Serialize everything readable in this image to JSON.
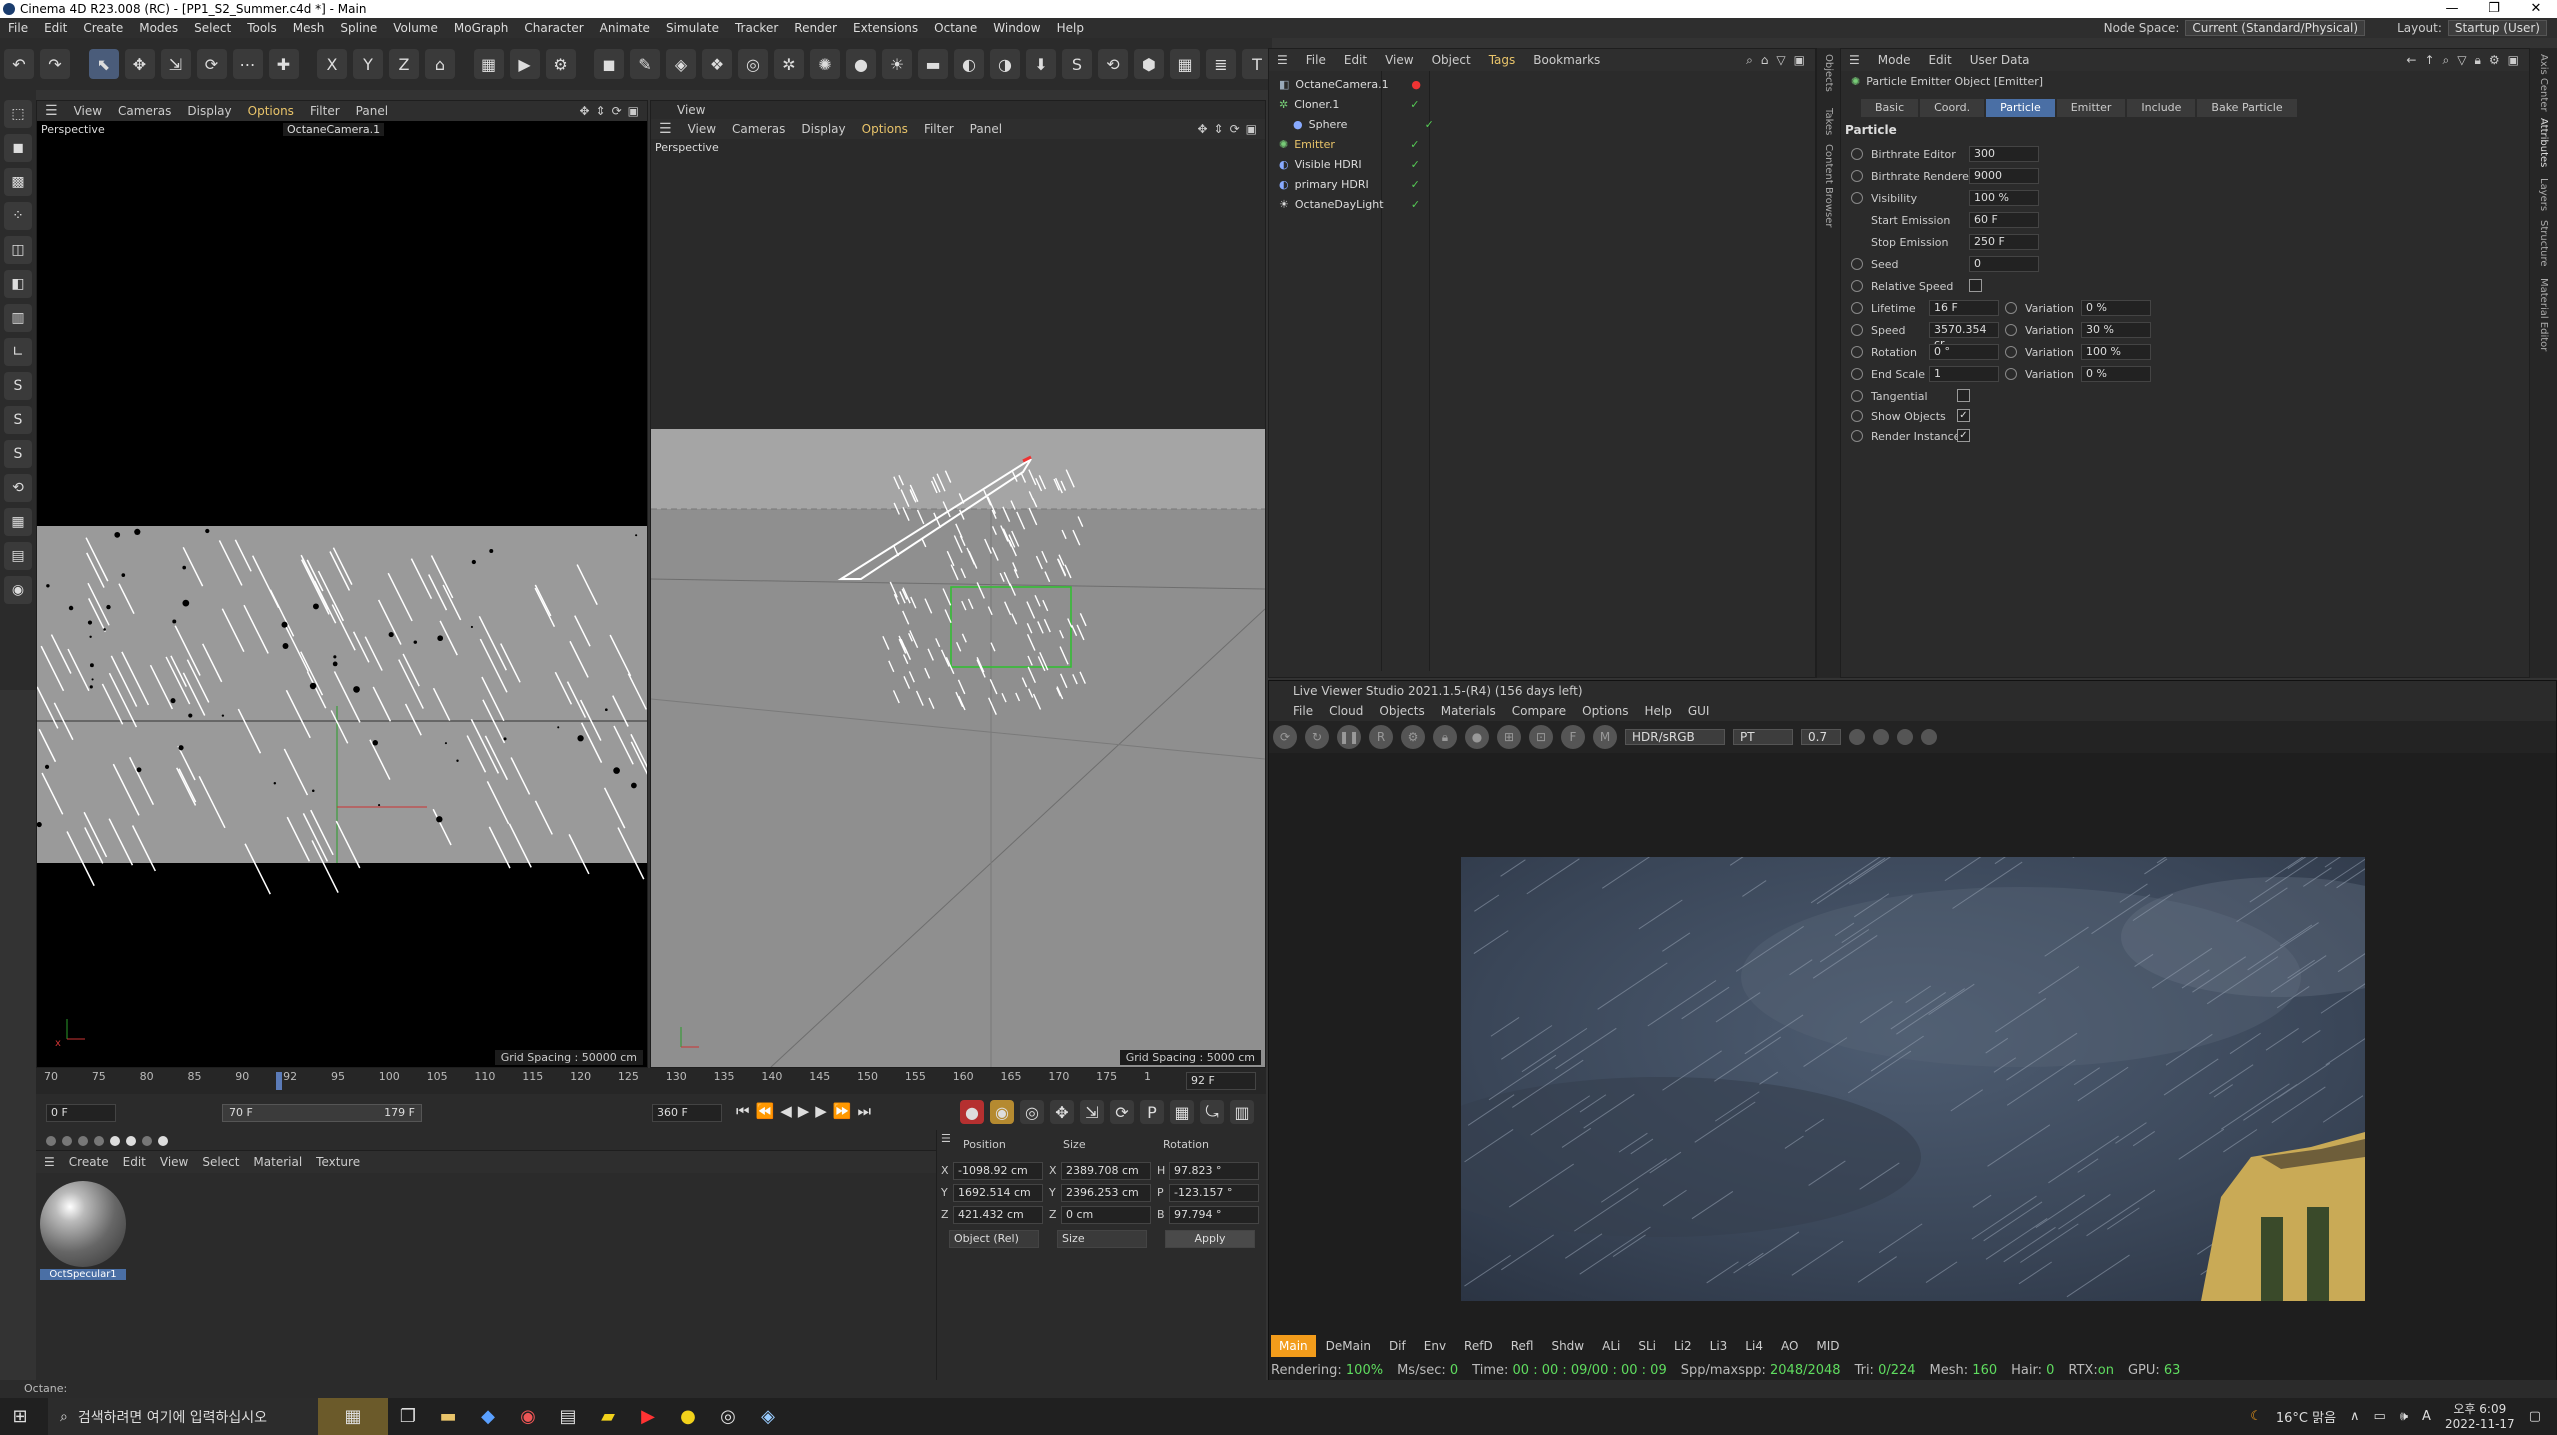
{
  "window": {
    "title": "Cinema 4D R23.008 (RC) - [PP1_S2_Summer.c4d *] - Main",
    "min": "—",
    "max": "❐",
    "close": "✕"
  },
  "menu": {
    "items": [
      "File",
      "Edit",
      "Create",
      "Modes",
      "Select",
      "Tools",
      "Mesh",
      "Spline",
      "Volume",
      "MoGraph",
      "Character",
      "Animate",
      "Simulate",
      "Tracker",
      "Render",
      "Extensions",
      "Octane",
      "Window",
      "Help"
    ],
    "node_space_label": "Node Space:",
    "node_space_value": "Current (Standard/Physical)",
    "layout_label": "Layout:",
    "layout_value": "Startup (User)"
  },
  "viewport_left": {
    "menu": [
      "View",
      "Cameras",
      "Display",
      "Options",
      "Filter",
      "Panel"
    ],
    "label": "Perspective",
    "camera": "OctaneCamera.1",
    "grid": "Grid Spacing : 50000 cm"
  },
  "viewport_right": {
    "header": "View",
    "menu": [
      "View",
      "Cameras",
      "Display",
      "Options",
      "Filter",
      "Panel"
    ],
    "label": "Perspective",
    "grid": "Grid Spacing : 5000 cm"
  },
  "timeline": {
    "ticks": [
      "70",
      "75",
      "80",
      "85",
      "90",
      "92",
      "95",
      "100",
      "105",
      "110",
      "115",
      "120",
      "125",
      "130",
      "135",
      "140",
      "145",
      "150",
      "155",
      "160",
      "165",
      "170",
      "175",
      "1"
    ],
    "current_frame": "92 F",
    "start": "0 F",
    "range_start": "70 F",
    "range_end": "179 F",
    "end": "360 F"
  },
  "material_panel": {
    "menu": [
      "Create",
      "Edit",
      "View",
      "Select",
      "Material",
      "Texture"
    ],
    "material_name": "OctSpecular1"
  },
  "coords": {
    "headers": [
      "Position",
      "Size",
      "Rotation"
    ],
    "rows": [
      {
        "axis": "X",
        "pos": "-1098.92 cm",
        "size_axis": "X",
        "size": "2389.708 cm",
        "rot_axis": "H",
        "rot": "97.823 °"
      },
      {
        "axis": "Y",
        "pos": "1692.514 cm",
        "size_axis": "Y",
        "size": "2396.253 cm",
        "rot_axis": "P",
        "rot": "-123.157 °"
      },
      {
        "axis": "Z",
        "pos": "421.432 cm",
        "size_axis": "Z",
        "size": "0 cm",
        "rot_axis": "B",
        "rot": "97.794 °"
      }
    ],
    "mode": "Object (Rel)",
    "size_mode": "Size",
    "apply": "Apply"
  },
  "objects": {
    "menu": [
      "File",
      "Edit",
      "View",
      "Object",
      "Tags",
      "Bookmarks"
    ],
    "list": [
      "OctaneCamera.1",
      "Cloner.1",
      "Sphere",
      "Emitter",
      "Visible HDRI",
      "primary HDRI",
      "OctaneDayLight"
    ]
  },
  "attributes": {
    "menu": [
      "Mode",
      "Edit",
      "User Data"
    ],
    "object_title": "Particle Emitter Object [Emitter]",
    "tabs": [
      "Basic",
      "Coord.",
      "Particle",
      "Emitter",
      "Include",
      "Bake Particle"
    ],
    "section": "Particle",
    "props": [
      {
        "label": "Birthrate Editor",
        "value": "300"
      },
      {
        "label": "Birthrate Renderer",
        "value": "9000"
      },
      {
        "label": "Visibility",
        "value": "100 %"
      },
      {
        "label": "Start Emission",
        "value": "60 F"
      },
      {
        "label": "Stop Emission",
        "value": "250 F"
      },
      {
        "label": "Seed",
        "value": "0"
      }
    ],
    "relative_speed": "Relative Speed",
    "var_props": [
      {
        "label": "Lifetime",
        "value": "16 F",
        "var": "0 %"
      },
      {
        "label": "Speed",
        "value": "3570.354 cr",
        "var": "30 %"
      },
      {
        "label": "Rotation",
        "value": "0 °",
        "var": "100 %"
      },
      {
        "label": "End Scale",
        "value": "1",
        "var": "0 %"
      }
    ],
    "variation_label": "Variation",
    "checks": [
      {
        "label": "Tangential",
        "checked": ""
      },
      {
        "label": "Show Objects",
        "checked": "✓"
      },
      {
        "label": "Render Instance",
        "checked": "✓"
      }
    ],
    "side_tabs": [
      "Objects",
      "Takes",
      "Content Browser"
    ],
    "right_tabs": [
      "Attributes",
      "Layers",
      "Structure",
      "Material Editor",
      "Axis Center"
    ]
  },
  "live_viewer": {
    "title": "Live Viewer Studio 2021.1.5-(R4) (156 days left)",
    "menu": [
      "File",
      "Cloud",
      "Objects",
      "Materials",
      "Compare",
      "Options",
      "Help",
      "GUI"
    ],
    "color_mode": "HDR/sRGB",
    "kernel": "PT",
    "value": "0.7",
    "passes": [
      "Main",
      "DeMain",
      "Dif",
      "Env",
      "RefD",
      "Refl",
      "Shdw",
      "ALi",
      "SLi",
      "Li2",
      "Li3",
      "Li4",
      "AO",
      "MID"
    ],
    "status": {
      "rendering_label": "Rendering:",
      "rendering": "100%",
      "ms_label": "Ms/sec:",
      "ms": "0",
      "time_label": "Time:",
      "time": "00 : 00 : 09/00 : 00 : 09",
      "spp_label": "Spp/maxspp:",
      "spp": "2048/2048",
      "tri_label": "Tri:",
      "tri": "0/224",
      "mesh_label": "Mesh:",
      "mesh": "160",
      "hair_label": "Hair:",
      "hair": "0",
      "rtx_label": "RTX:",
      "rtx": "on",
      "gpu_label": "GPU:",
      "gpu": "63"
    }
  },
  "statusline": "Octane:",
  "taskbar": {
    "search_placeholder": "검색하려면 여기에 입력하십시오",
    "weather": "16°C 맑음",
    "time": "오후 6:09",
    "date": "2022-11-17"
  },
  "colors": {
    "accent": "#4a6fa5",
    "octane_orange": "#f29c1b",
    "gpu_green": "#5fdc5f"
  }
}
